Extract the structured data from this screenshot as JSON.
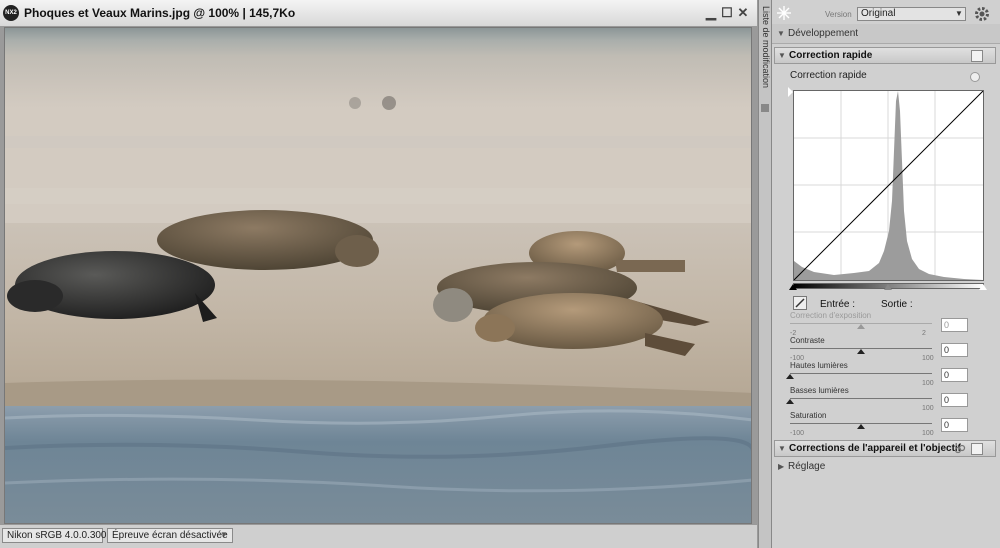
{
  "window": {
    "title": "Phoques et Veaux Marins.jpg @ 100% | 145,7Ko",
    "app_icon_text": "NX2"
  },
  "status_bar": {
    "profile": "Nikon sRGB 4.0.0.3002",
    "soft_proof": "Épreuve écran désactivée",
    "soft_proof_arrow": "▼"
  },
  "side_tab": {
    "label": "Liste de modification"
  },
  "panel": {
    "version_label": "Version",
    "version_value": "Original",
    "dropdown_arrow": "▼",
    "development": "Développement",
    "quick_fix_header": "Correction rapide",
    "quick_fix_sub": "Correction rapide",
    "input_label": "Entrée :",
    "output_label": "Sortie :",
    "lens_corrections": "Corrections de l'appareil et l'objectif",
    "adjust": "Réglage",
    "sliders": [
      {
        "label": "Correction d'exposition",
        "min": "-2",
        "max": "2",
        "value": "0",
        "position": 0.5,
        "disabled": true
      },
      {
        "label": "Contraste",
        "min": "-100",
        "max": "100",
        "value": "0",
        "position": 0.5,
        "disabled": false
      },
      {
        "label": "Hautes lumières",
        "min": "",
        "max": "100",
        "value": "0",
        "position": 0.0,
        "disabled": false
      },
      {
        "label": "Basses lumières",
        "min": "",
        "max": "100",
        "value": "0",
        "position": 0.0,
        "disabled": false
      },
      {
        "label": "Saturation",
        "min": "-100",
        "max": "100",
        "value": "0",
        "position": 0.5,
        "disabled": false
      }
    ]
  },
  "icons": {
    "minimize": "minimize-icon",
    "maximize": "maximize-icon",
    "close": "close-icon",
    "settings": "gear-icon",
    "sparkle": "sparkle-icon",
    "eyedropper": "eyedropper-icon",
    "link": "link-icon"
  }
}
